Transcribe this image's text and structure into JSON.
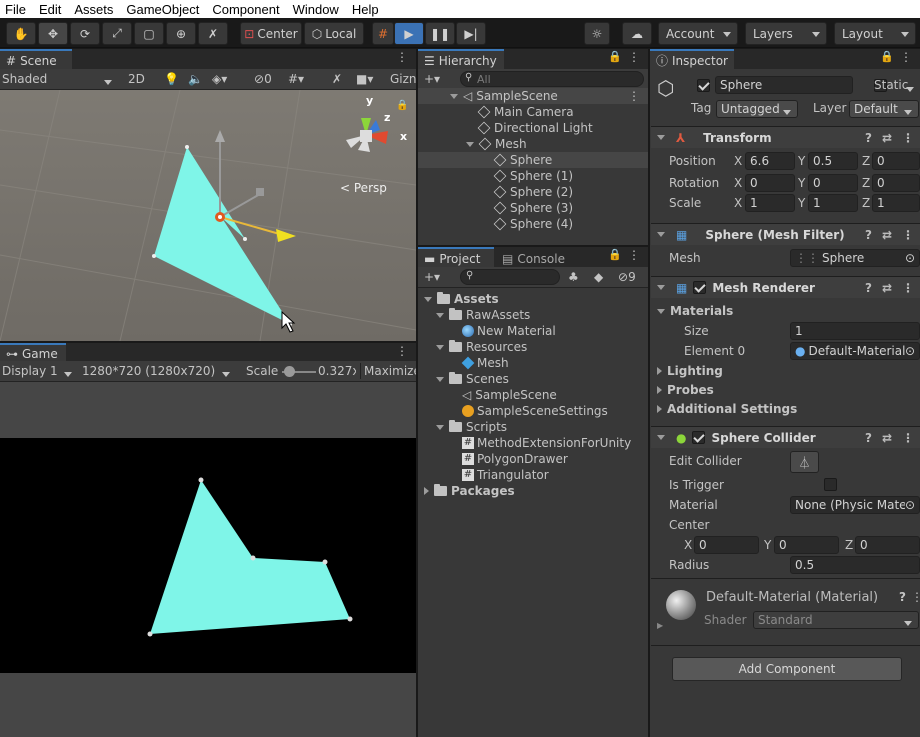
{
  "menu": [
    "File",
    "Edit",
    "Assets",
    "GameObject",
    "Component",
    "Window",
    "Help"
  ],
  "toolbar": {
    "pivot": "Center",
    "space": "Local",
    "account": "Account",
    "layers": "Layers",
    "layout": "Layout"
  },
  "scene": {
    "tab": "Scene",
    "shading": "Shaded",
    "mode2d": "2D",
    "hidden_count": "0",
    "gizmos": "Gizn",
    "persp": "Persp",
    "axis_y": "y",
    "axis_z": "z",
    "axis_x": "x"
  },
  "game": {
    "tab": "Game",
    "display": "Display 1",
    "resolution": "1280*720 (1280x720)",
    "scale_label": "Scale",
    "scale_value": "0.327x",
    "maximize": "Maximize"
  },
  "hierarchy": {
    "tab": "Hierarchy",
    "search_placeholder": "All",
    "scene_name": "SampleScene",
    "items": [
      "Main Camera",
      "Directional Light",
      "Mesh",
      "Sphere",
      "Sphere (1)",
      "Sphere (2)",
      "Sphere (3)",
      "Sphere (4)"
    ]
  },
  "project": {
    "tab": "Project",
    "console_tab": "Console",
    "hidden_count": "9",
    "assets": "Assets",
    "rawassets": "RawAssets",
    "new_material": "New Material",
    "resources": "Resources",
    "mesh": "Mesh",
    "scenes": "Scenes",
    "sample_scene": "SampleScene",
    "sample_scene_settings": "SampleSceneSettings",
    "scripts": "Scripts",
    "script1": "MethodExtensionForUnity",
    "script2": "PolygonDrawer",
    "script3": "Triangulator",
    "packages": "Packages"
  },
  "inspector": {
    "tab": "Inspector",
    "object_name": "Sphere",
    "static": "Static",
    "tag_label": "Tag",
    "tag": "Untagged",
    "layer_label": "Layer",
    "layer": "Default",
    "transform": {
      "title": "Transform",
      "position_label": "Position",
      "rotation_label": "Rotation",
      "scale_label": "Scale",
      "px": "6.6",
      "py": "0.5",
      "pz": "0",
      "rx": "0",
      "ry": "0",
      "rz": "0",
      "sx": "1",
      "sy": "1",
      "sz": "1"
    },
    "mesh_filter": {
      "title": "Sphere (Mesh Filter)",
      "label": "Mesh",
      "value": "Sphere"
    },
    "mesh_renderer": {
      "title": "Mesh Renderer",
      "materials": "Materials",
      "size_label": "Size",
      "size": "1",
      "element_label": "Element 0",
      "element": "Default-Material",
      "lighting": "Lighting",
      "probes": "Probes",
      "additional": "Additional Settings"
    },
    "collider": {
      "title": "Sphere Collider",
      "edit_label": "Edit Collider",
      "trigger_label": "Is Trigger",
      "material_label": "Material",
      "material": "None (Physic Mate",
      "center_label": "Center",
      "cx": "0",
      "cy": "0",
      "cz": "0",
      "radius_label": "Radius",
      "radius": "0.5"
    },
    "material": {
      "title": "Default-Material (Material)",
      "shader_label": "Shader",
      "shader": "Standard"
    },
    "add_component": "Add Component"
  },
  "colors": {
    "accent": "#3a79bb",
    "mesh": "#7ff5e8"
  }
}
